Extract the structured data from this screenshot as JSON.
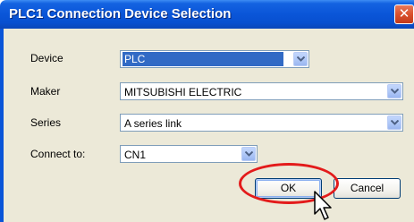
{
  "dialog": {
    "title": "PLC1 Connection Device Selection",
    "close_glyph": "✕"
  },
  "fields": {
    "device": {
      "label": "Device",
      "value": "PLC"
    },
    "maker": {
      "label": "Maker",
      "value": "MITSUBISHI ELECTRIC"
    },
    "series": {
      "label": "Series",
      "value": "A series link"
    },
    "connect": {
      "label": "Connect to:",
      "value": "CN1"
    }
  },
  "buttons": {
    "ok_label": "OK",
    "cancel_label": "Cancel"
  },
  "icons": {
    "close": "close-icon",
    "dropdown": "chevron-down-icon",
    "cursor": "mouse-pointer-icon"
  },
  "colors": {
    "titlebar": "#0a55d8",
    "dialog_bg": "#ece9d8",
    "selection": "#316ac5",
    "highlight": "#e31b1b"
  }
}
